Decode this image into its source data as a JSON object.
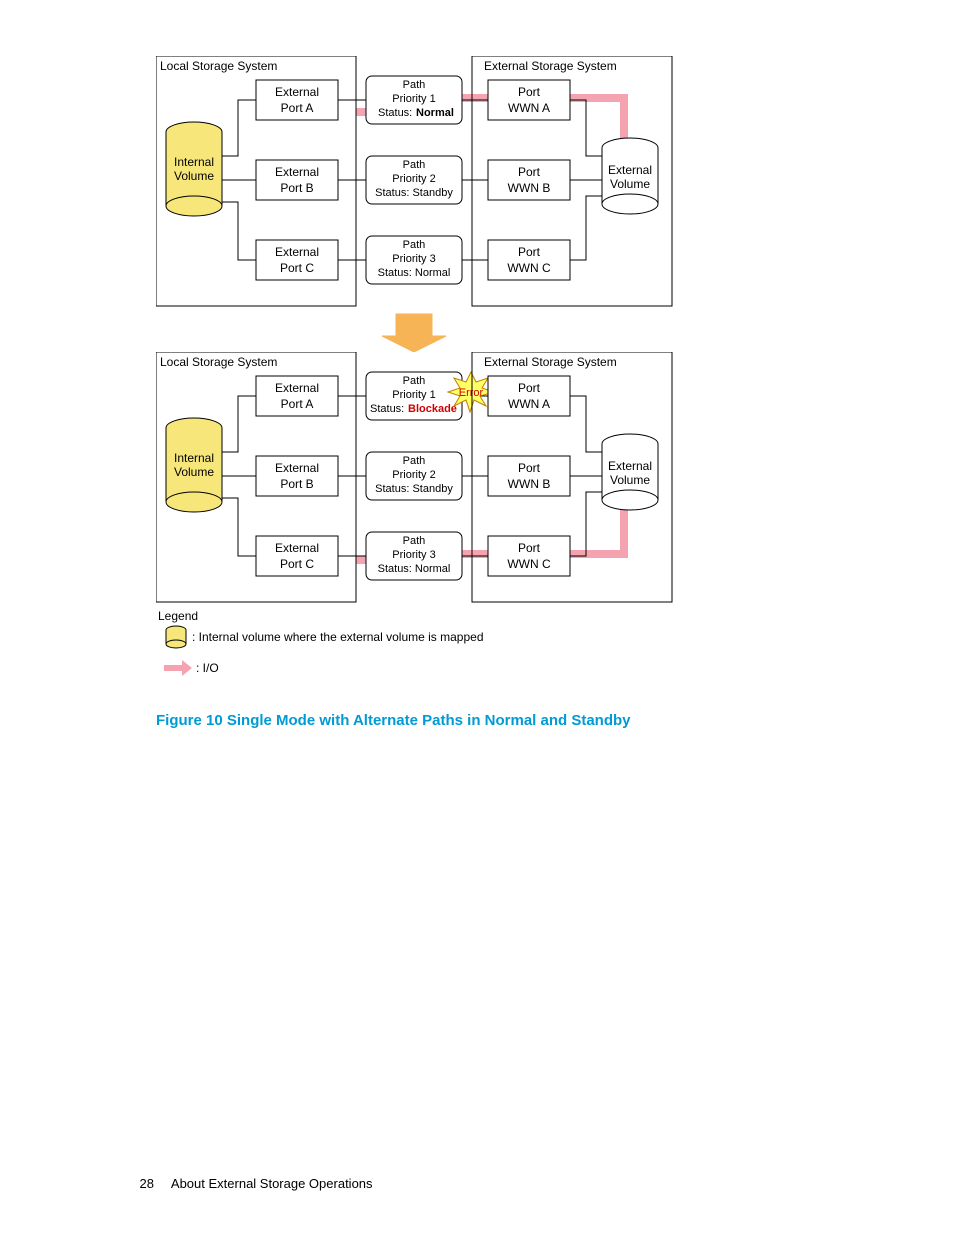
{
  "page_number": "28",
  "section_title": "About External Storage Operations",
  "caption": "Figure 10 Single Mode with Alternate Paths in Normal and Standby",
  "diagram1": {
    "local_label": "Local Storage System",
    "external_label": "External Storage System",
    "internal_volume_l1": "Internal",
    "internal_volume_l2": "Volume",
    "external_volume_l1": "External",
    "external_volume_l2": "Volume",
    "portA_l1": "External",
    "portA_l2": "Port A",
    "portB_l1": "External",
    "portB_l2": "Port B",
    "portC_l1": "External",
    "portC_l2": "Port C",
    "wwnA_l1": "Port",
    "wwnA_l2": "WWN A",
    "wwnB_l1": "Port",
    "wwnB_l2": "WWN B",
    "wwnC_l1": "Port",
    "wwnC_l2": "WWN C",
    "path1_l1": "Path",
    "path1_l2": "Priority 1",
    "path1_l3a": "Status: ",
    "path1_l3b": "Normal",
    "path2_l1": "Path",
    "path2_l2": "Priority 2",
    "path2_l3": "Status: Standby",
    "path3_l1": "Path",
    "path3_l2": "Priority 3",
    "path3_l3": "Status: Normal"
  },
  "diagram2": {
    "local_label": "Local Storage System",
    "external_label": "External Storage System",
    "internal_volume_l1": "Internal",
    "internal_volume_l2": "Volume",
    "external_volume_l1": "External",
    "external_volume_l2": "Volume",
    "portA_l1": "External",
    "portA_l2": "Port A",
    "portB_l1": "External",
    "portB_l2": "Port B",
    "portC_l1": "External",
    "portC_l2": "Port C",
    "wwnA_l1": "Port",
    "wwnA_l2": "WWN A",
    "wwnB_l1": "Port",
    "wwnB_l2": "WWN B",
    "wwnC_l1": "Port",
    "wwnC_l2": "WWN C",
    "path1_l1": "Path",
    "path1_l2": "Priority 1",
    "path1_l3a": "Status: ",
    "path1_l3b": "Blockade",
    "path2_l1": "Path",
    "path2_l2": "Priority 2",
    "path2_l3": "Status: Standby",
    "path3_l1": "Path",
    "path3_l2": "Priority 3",
    "path3_l3": "Status: Normal",
    "error_label": "Error"
  },
  "legend": {
    "title": "Legend",
    "cyl": ": Internal volume where the external volume is mapped",
    "io": ": I/O"
  }
}
